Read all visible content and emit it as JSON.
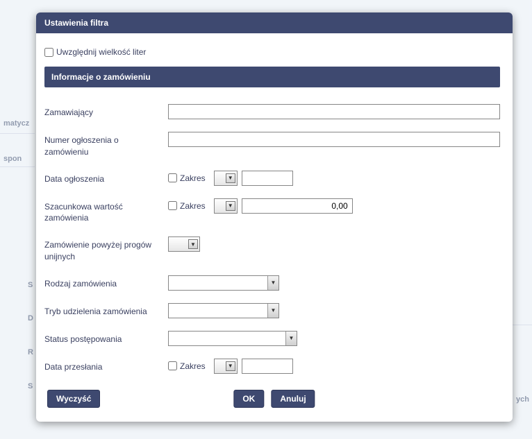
{
  "dialog": {
    "title": "Ustawienia filtra",
    "case_sensitive_label": "Uwzględnij wielkość liter",
    "section_title": "Informacje o zamówieniu",
    "fields": {
      "zamawiajacy": {
        "label": "Zamawiający",
        "value": ""
      },
      "numer": {
        "label": "Numer ogłoszenia o zamówieniu",
        "value": ""
      },
      "data_ogl": {
        "label": "Data ogłoszenia",
        "zakres_label": "Zakres",
        "value": ""
      },
      "szac": {
        "label": "Szacunkowa wartość zamówienia",
        "zakres_label": "Zakres",
        "value": "0,00"
      },
      "progi": {
        "label": "Zamówienie powyżej progów unijnych",
        "value": ""
      },
      "rodzaj": {
        "label": "Rodzaj zamówienia",
        "value": ""
      },
      "tryb": {
        "label": "Tryb udzielenia zamówienia",
        "value": ""
      },
      "status": {
        "label": "Status postępowania",
        "value": ""
      },
      "data_prz": {
        "label": "Data przesłania",
        "zakres_label": "Zakres",
        "value": ""
      }
    },
    "buttons": {
      "clear": "Wyczyść",
      "ok": "OK",
      "cancel": "Anuluj"
    }
  },
  "background": {
    "left1": "matycz",
    "left2": "spon",
    "left3": "S",
    "left4": "D",
    "left5": "R",
    "left6": "S",
    "right1": "ych"
  }
}
